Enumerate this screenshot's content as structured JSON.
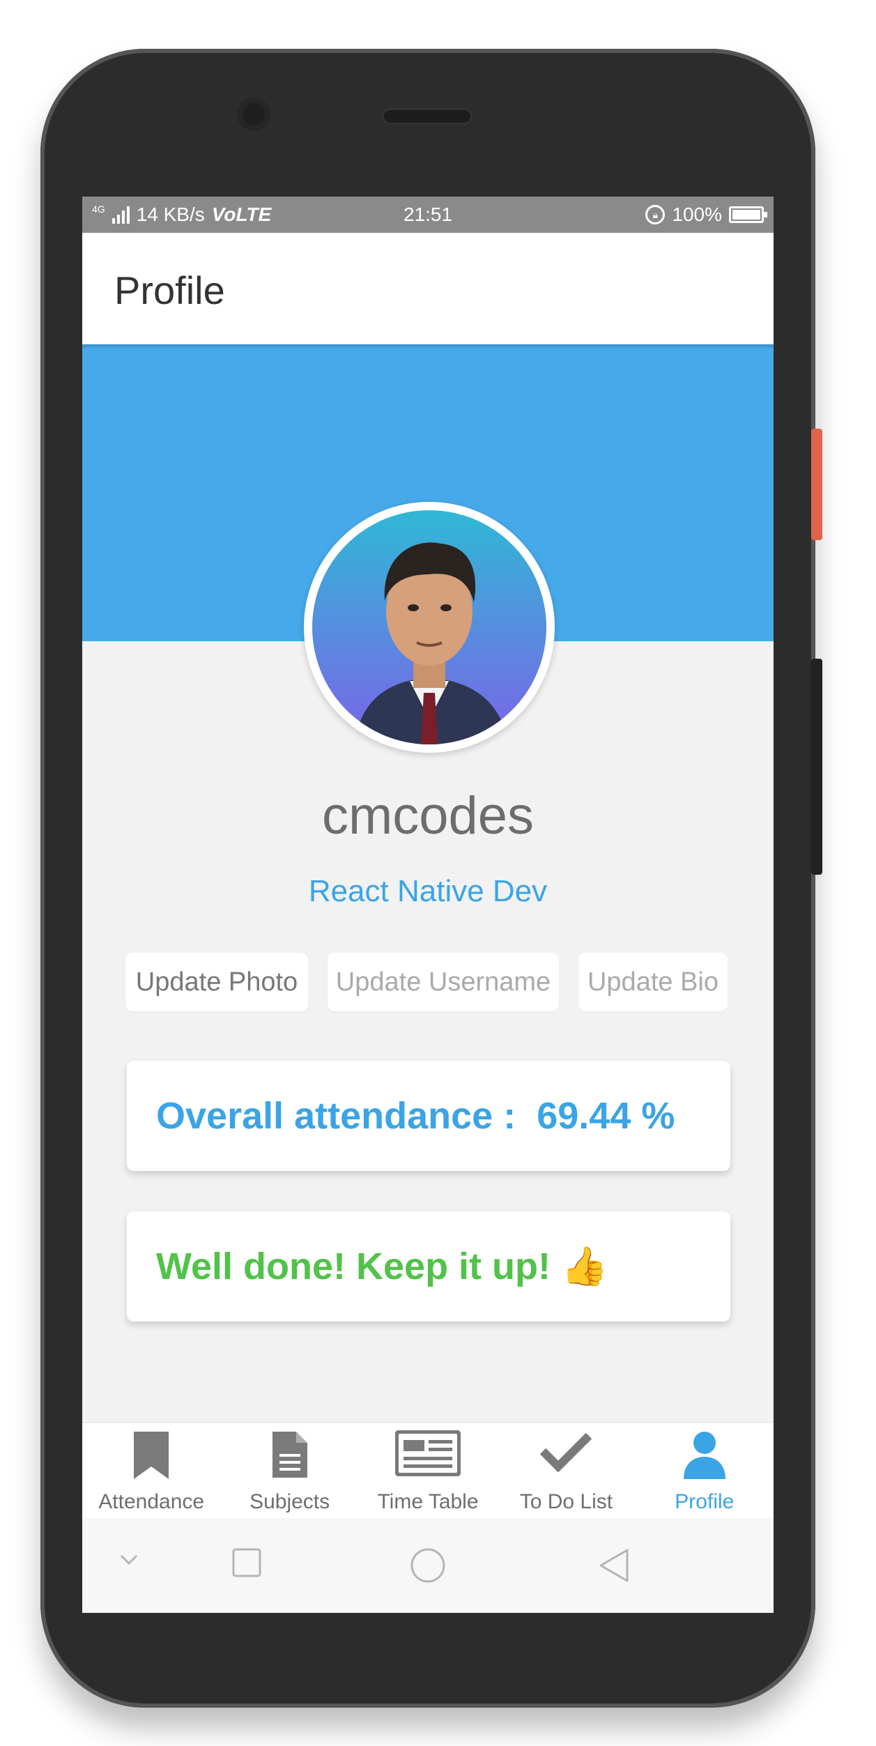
{
  "status_bar": {
    "network_tag": "4G",
    "speed": "14 KB/s",
    "volte": "VoLTE",
    "time": "21:51",
    "battery": "100%"
  },
  "header": {
    "title": "Profile"
  },
  "profile": {
    "username": "cmcodes",
    "bio": "React Native Dev"
  },
  "actions": {
    "update_photo": "Update Photo",
    "update_username": "Update Username",
    "update_bio": "Update Bio"
  },
  "attendance_card": {
    "label": "Overall attendance :",
    "value": "69.44 %"
  },
  "message_card": {
    "text": "Well done! Keep it up!",
    "emoji": "👍"
  },
  "tabs": [
    {
      "label": "Attendance",
      "icon": "bookmark-icon",
      "active": false
    },
    {
      "label": "Subjects",
      "icon": "document-icon",
      "active": false
    },
    {
      "label": "Time Table",
      "icon": "newspaper-icon",
      "active": false
    },
    {
      "label": "To Do List",
      "icon": "check-icon",
      "active": false
    },
    {
      "label": "Profile",
      "icon": "user-icon",
      "active": true
    }
  ],
  "colors": {
    "accent": "#46aaea",
    "success": "#52c24a",
    "status_bar": "#8a8a8a"
  }
}
